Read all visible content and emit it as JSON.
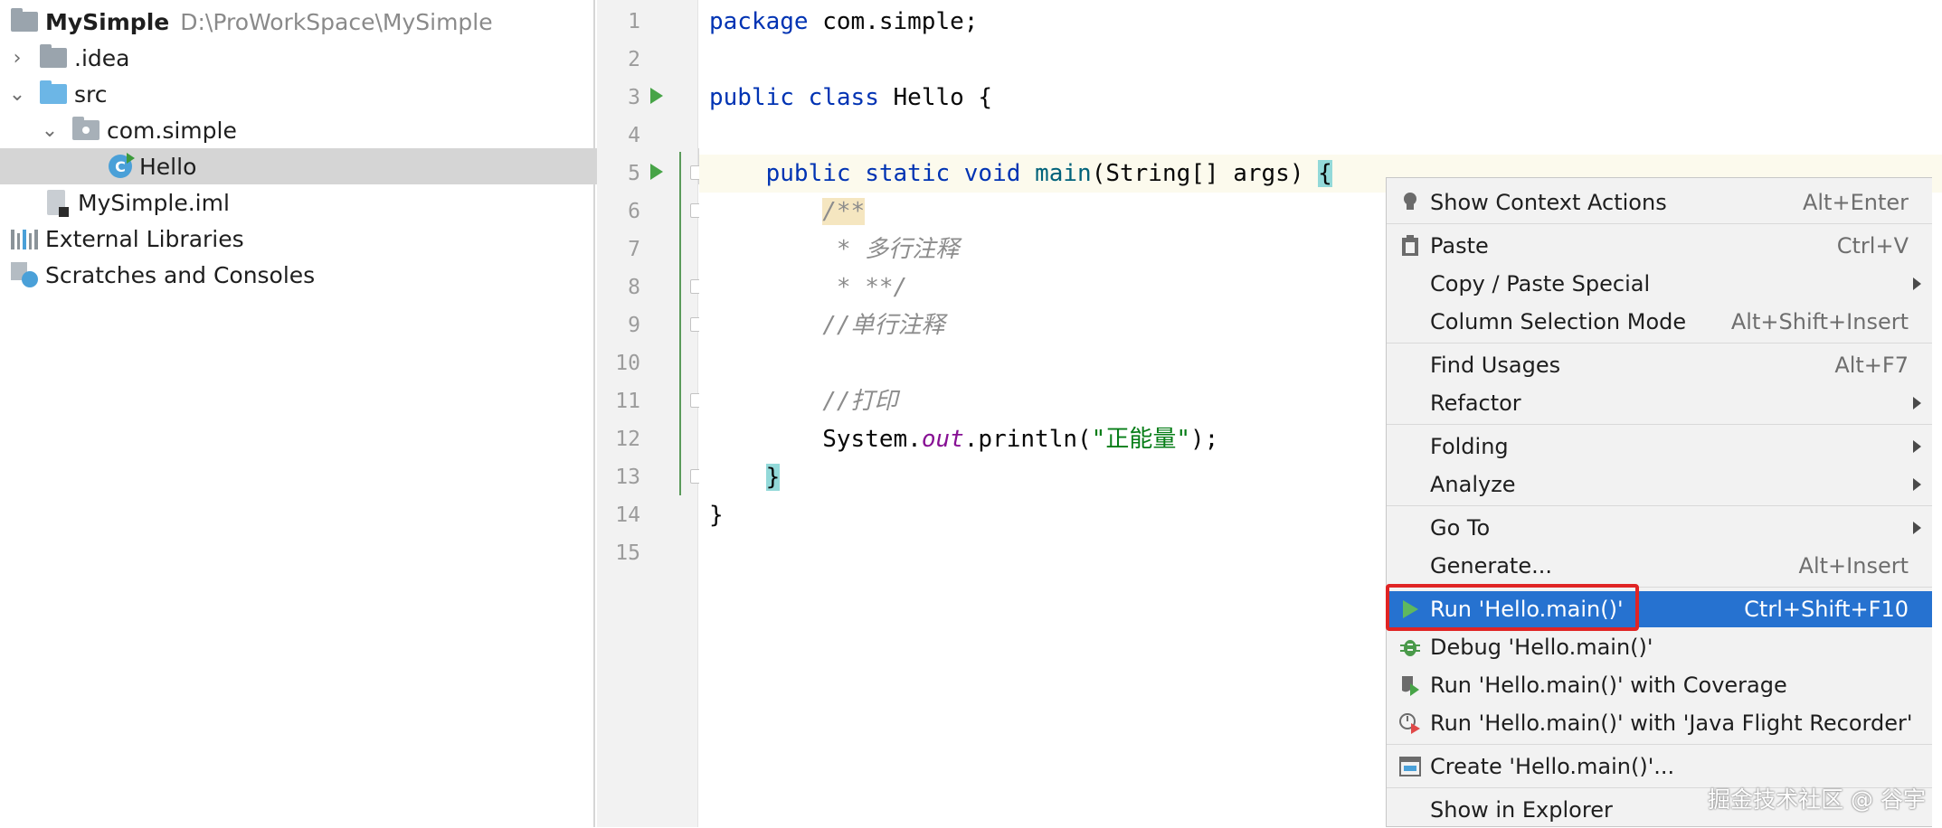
{
  "project_tree": {
    "root": {
      "name": "MySimple",
      "path": "D:\\ProWorkSpace\\MySimple"
    },
    "items": [
      {
        "label": ".idea",
        "icon": "folder-icon"
      },
      {
        "label": "src",
        "icon": "source-folder-icon"
      },
      {
        "label": "com.simple",
        "icon": "package-icon"
      },
      {
        "label": "Hello",
        "icon": "java-class-icon"
      },
      {
        "label": "MySimple.iml",
        "icon": "module-file-icon"
      },
      {
        "label": "External Libraries",
        "icon": "libraries-icon"
      },
      {
        "label": "Scratches and Consoles",
        "icon": "scratches-icon"
      }
    ]
  },
  "editor": {
    "line_numbers": [
      "1",
      "2",
      "3",
      "4",
      "5",
      "6",
      "7",
      "8",
      "9",
      "10",
      "11",
      "12",
      "13",
      "14",
      "15"
    ],
    "tokens": {
      "package": "package",
      "package_name": " com.simple;",
      "public": "public",
      "class": "class",
      "class_name": " Hello {",
      "static": "static",
      "void": "void",
      "main": "main",
      "main_params": "(String[] args) ",
      "open_brace": "{",
      "doc_open": "/**",
      "doc_line": " * 多行注释",
      "doc_close": " * **/",
      "comment_single": "//单行注释",
      "comment_print": "//打印",
      "sys_prefix": "System.",
      "sys_out": "out",
      "sys_println": ".println(",
      "sys_string": "\"正能量\"",
      "sys_end": ");",
      "close_brace_inner": "}",
      "close_brace_outer": "}"
    }
  },
  "context_menu": {
    "items": [
      {
        "label": "Show Context Actions",
        "shortcut": "Alt+Enter",
        "icon": "lightbulb-icon"
      },
      {
        "label": "Paste",
        "shortcut": "Ctrl+V",
        "icon": "clipboard-icon"
      },
      {
        "label": "Copy / Paste Special",
        "shortcut": ""
      },
      {
        "label": "Column Selection Mode",
        "shortcut": "Alt+Shift+Insert"
      },
      {
        "label": "Find Usages",
        "shortcut": "Alt+F7"
      },
      {
        "label": "Refactor",
        "shortcut": ""
      },
      {
        "label": "Folding",
        "shortcut": ""
      },
      {
        "label": "Analyze",
        "shortcut": ""
      },
      {
        "label": "Go To",
        "shortcut": ""
      },
      {
        "label": "Generate...",
        "shortcut": "Alt+Insert"
      },
      {
        "label": "Run 'Hello.main()'",
        "shortcut": "Ctrl+Shift+F10",
        "icon": "run-icon"
      },
      {
        "label": "Debug 'Hello.main()'",
        "shortcut": "",
        "icon": "debug-icon"
      },
      {
        "label": "Run 'Hello.main()' with Coverage",
        "shortcut": "",
        "icon": "coverage-icon"
      },
      {
        "label": "Run 'Hello.main()' with 'Java Flight Recorder'",
        "shortcut": "",
        "icon": "profiler-icon"
      },
      {
        "label": "Create 'Hello.main()'...",
        "shortcut": "",
        "icon": "run-config-icon"
      },
      {
        "label": "Show in Explorer",
        "shortcut": ""
      }
    ]
  },
  "watermark": "掘金技术社区 @ 谷宇",
  "colors": {
    "selection": "#2672d0",
    "keyword": "#0033b3",
    "string": "#067d17",
    "highlight_box": "#e02424",
    "run_green": "#47a447"
  }
}
